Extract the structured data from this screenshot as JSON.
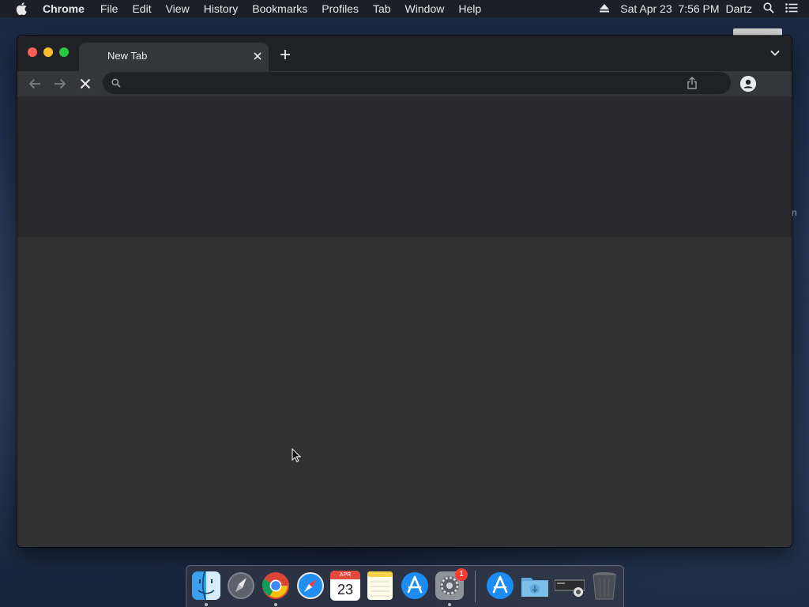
{
  "menubar": {
    "app_name": "Chrome",
    "items": [
      "File",
      "Edit",
      "View",
      "History",
      "Bookmarks",
      "Profiles",
      "Tab",
      "Window",
      "Help"
    ],
    "datetime": "Sat Apr 23  7:56 PM",
    "user": "Dartz"
  },
  "desktop": {
    "partial_label": "n"
  },
  "browser": {
    "tab": {
      "title": "New Tab"
    },
    "omnibox": {
      "value": "",
      "placeholder": ""
    }
  },
  "dock": {
    "items": [
      "Finder",
      "Launchpad",
      "Google Chrome",
      "Safari",
      "Calendar",
      "Notes",
      "App Store",
      "System Preferences",
      "Applications",
      "Downloads",
      "Recent Screenshot",
      "Trash"
    ],
    "calendar": {
      "month": "APR",
      "day": "23"
    },
    "system_preferences_badge": "1"
  },
  "colors": {
    "traffic_close": "#ff5f57",
    "traffic_minimize": "#febc2e",
    "traffic_maximize": "#28c840",
    "badge": "#ff3b30"
  }
}
